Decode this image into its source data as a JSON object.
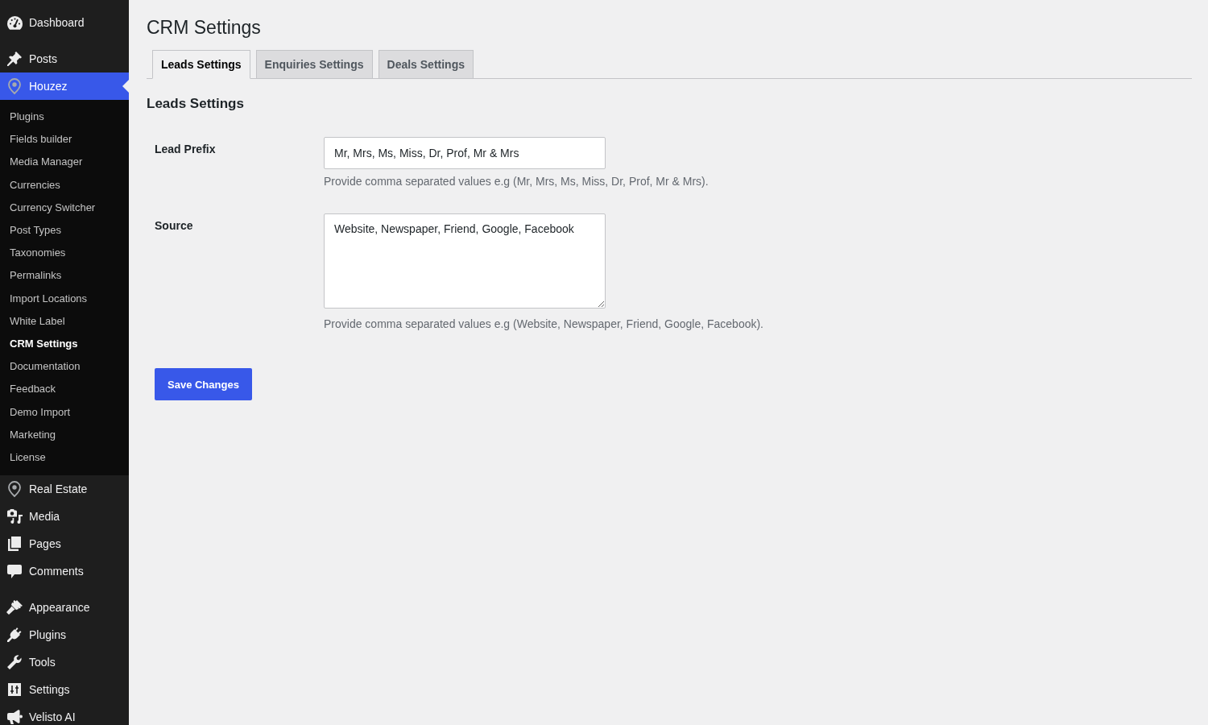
{
  "sidebar": {
    "groups": [
      {
        "items": [
          {
            "label": "Dashboard",
            "selected": false
          }
        ]
      },
      {
        "items": [
          {
            "label": "Posts",
            "selected": false
          },
          {
            "label": "Houzez",
            "selected": true,
            "children": [
              {
                "label": "Plugins",
                "selected": false
              },
              {
                "label": "Fields builder",
                "selected": false
              },
              {
                "label": "Media Manager",
                "selected": false
              },
              {
                "label": "Currencies",
                "selected": false
              },
              {
                "label": "Currency Switcher",
                "selected": false
              },
              {
                "label": "Post Types",
                "selected": false
              },
              {
                "label": "Taxonomies",
                "selected": false
              },
              {
                "label": "Permalinks",
                "selected": false
              },
              {
                "label": "Import Locations",
                "selected": false
              },
              {
                "label": "White Label",
                "selected": false
              },
              {
                "label": "CRM Settings",
                "selected": true
              },
              {
                "label": "Documentation",
                "selected": false
              },
              {
                "label": "Feedback",
                "selected": false
              },
              {
                "label": "Demo Import",
                "selected": false
              },
              {
                "label": "Marketing",
                "selected": false
              },
              {
                "label": "License",
                "selected": false
              }
            ]
          },
          {
            "label": "Real Estate",
            "selected": false
          },
          {
            "label": "Media",
            "selected": false
          },
          {
            "label": "Pages",
            "selected": false
          },
          {
            "label": "Comments",
            "selected": false
          }
        ]
      },
      {
        "items": [
          {
            "label": "Appearance",
            "selected": false
          },
          {
            "label": "Plugins",
            "selected": false
          },
          {
            "label": "Tools",
            "selected": false
          },
          {
            "label": "Settings",
            "selected": false
          },
          {
            "label": "Velisto AI",
            "selected": false
          }
        ]
      }
    ]
  },
  "page": {
    "title": "CRM Settings"
  },
  "tabs": [
    {
      "label": "Leads Settings",
      "selected": true
    },
    {
      "label": "Enquiries Settings",
      "selected": false
    },
    {
      "label": "Deals Settings",
      "selected": false
    }
  ],
  "section": {
    "title": "Leads Settings"
  },
  "fields": [
    {
      "kind": "text",
      "label": "Lead Prefix",
      "value": "Mr, Mrs, Ms, Miss, Dr, Prof, Mr & Mrs",
      "description": "Provide comma separated values e.g (Mr, Mrs, Ms, Miss, Dr, Prof, Mr & Mrs)."
    },
    {
      "kind": "textarea",
      "label": "Source",
      "value": "Website, Newspaper, Friend, Google, Facebook",
      "description": "Provide comma separated values e.g (Website, Newspaper, Friend, Google, Facebook)."
    }
  ],
  "save_button": {
    "label": "Save Changes"
  }
}
